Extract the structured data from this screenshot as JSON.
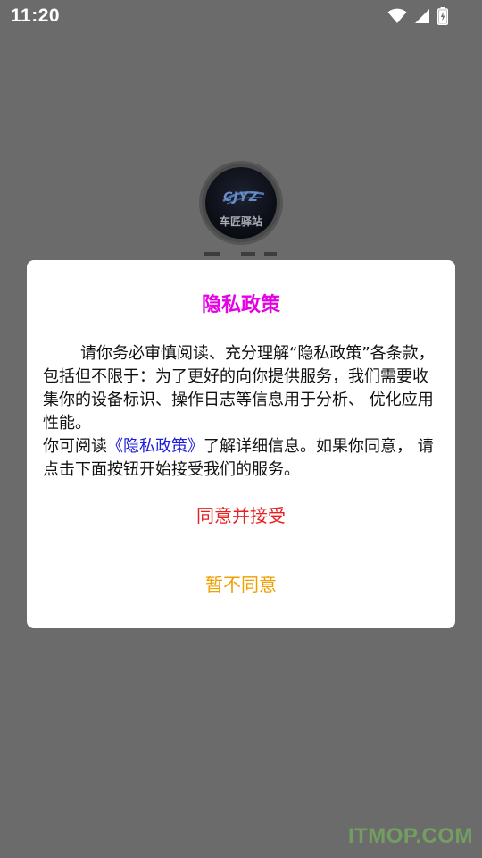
{
  "status_bar": {
    "time": "11:20",
    "icons": [
      "wifi-icon",
      "cellular-signal-icon",
      "battery-charging-icon"
    ]
  },
  "app_logo": {
    "mark_text": "CJYZ",
    "name_text": "车匠驿站"
  },
  "dialog": {
    "title": "隐私政策",
    "paragraph1": "请你务必审慎阅读、充分理解“隐私政策”各条款，包括但不限于：为了更好的向你提供服务，我们需要收集你的设备标识、操作日志等信息用于分析、 优化应用性能。",
    "paragraph2_prefix": "你可阅读",
    "policy_link": "《隐私政策》",
    "paragraph2_suffix": "了解详细信息。如果你同意， 请点击下面按钮开始接受我们的服务。",
    "agree_label": "同意并接受",
    "decline_label": "暂不同意"
  },
  "watermark": "ITMOP.COM",
  "colors": {
    "overlay": "#6b6b6b",
    "title": "#e600e6",
    "link": "#1b1bde",
    "agree": "#e82020",
    "decline": "#f0a000"
  }
}
